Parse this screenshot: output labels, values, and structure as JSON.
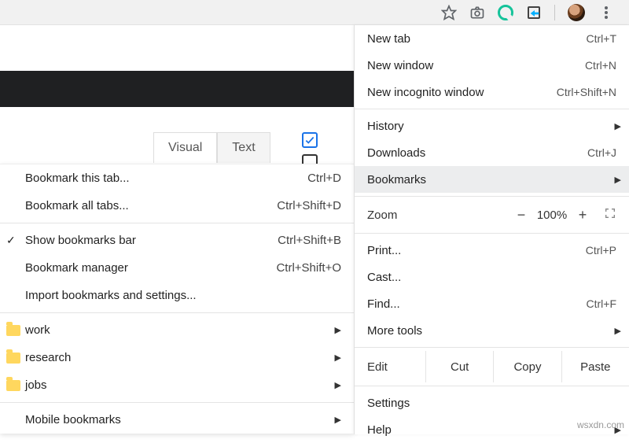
{
  "toolbar": {
    "icons": {
      "star": "star-icon",
      "camera": "camera-icon",
      "grammarly": "grammarly-icon",
      "share": "share-icon",
      "avatar": "avatar",
      "menu": "kebab-menu-icon"
    }
  },
  "editor": {
    "tab_visual": "Visual",
    "tab_text": "Text"
  },
  "main_menu": {
    "new_tab": "New tab",
    "new_tab_sc": "Ctrl+T",
    "new_window": "New window",
    "new_window_sc": "Ctrl+N",
    "new_incognito": "New incognito window",
    "new_incognito_sc": "Ctrl+Shift+N",
    "history": "History",
    "downloads": "Downloads",
    "downloads_sc": "Ctrl+J",
    "bookmarks": "Bookmarks",
    "zoom_label": "Zoom",
    "zoom_minus": "−",
    "zoom_value": "100%",
    "zoom_plus": "+",
    "print": "Print...",
    "print_sc": "Ctrl+P",
    "cast": "Cast...",
    "find": "Find...",
    "find_sc": "Ctrl+F",
    "more_tools": "More tools",
    "edit": "Edit",
    "cut": "Cut",
    "copy": "Copy",
    "paste": "Paste",
    "settings": "Settings",
    "help": "Help"
  },
  "bookmarks_menu": {
    "bookmark_tab": "Bookmark this tab...",
    "bookmark_tab_sc": "Ctrl+D",
    "bookmark_all": "Bookmark all tabs...",
    "bookmark_all_sc": "Ctrl+Shift+D",
    "show_bar": "Show bookmarks bar",
    "show_bar_sc": "Ctrl+Shift+B",
    "manager": "Bookmark manager",
    "manager_sc": "Ctrl+Shift+O",
    "import": "Import bookmarks and settings...",
    "folders": [
      "work",
      "research",
      "jobs"
    ],
    "mobile": "Mobile bookmarks"
  },
  "watermark": "wsxdn.com"
}
